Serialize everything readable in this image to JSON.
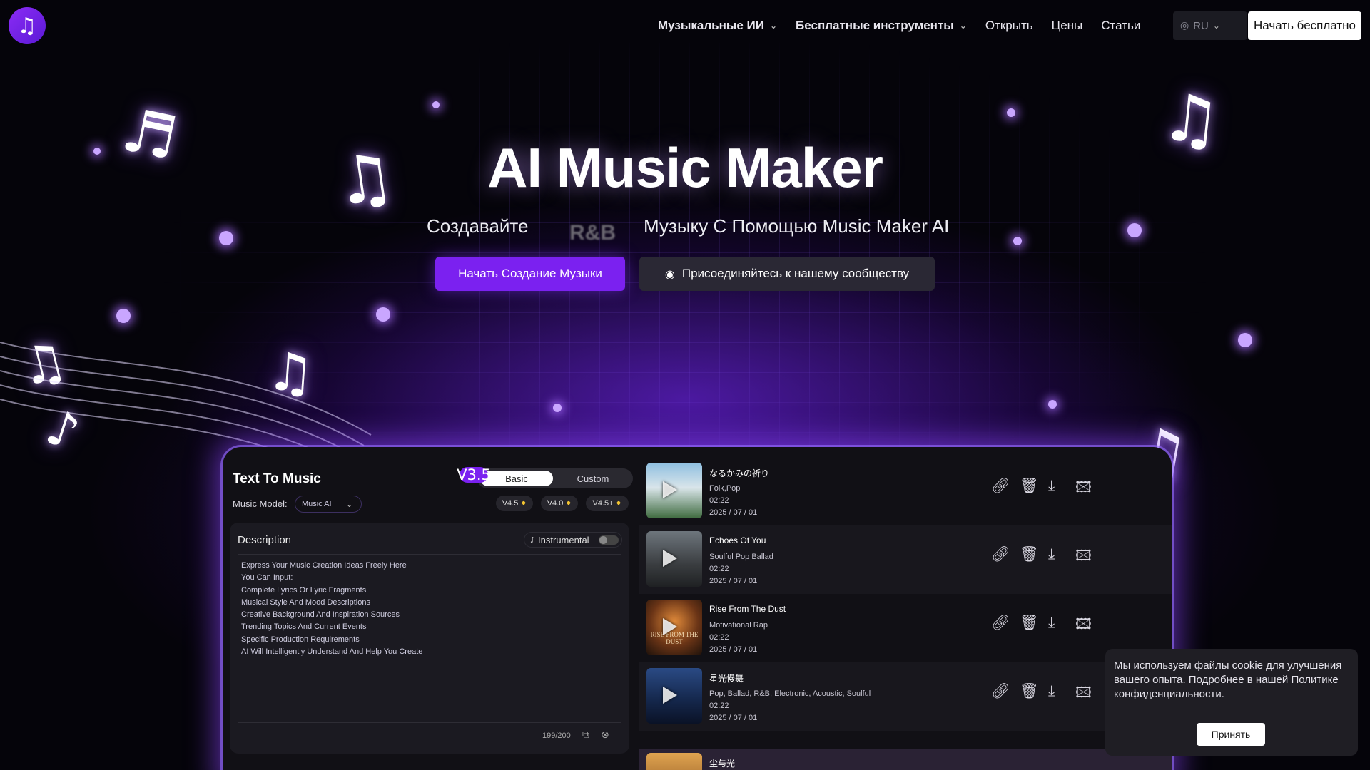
{
  "header": {
    "logo_glyph": "♫",
    "nav": [
      {
        "label": "Музыкальные ИИ",
        "dropdown": true
      },
      {
        "label": "Бесплатные инструменты",
        "dropdown": true
      },
      {
        "label": "Открыть",
        "dropdown": false
      },
      {
        "label": "Цены",
        "dropdown": false
      },
      {
        "label": "Статьи",
        "dropdown": false
      }
    ],
    "language": "RU",
    "start_free": "Начать бесплатно"
  },
  "hero": {
    "title": "AI Music Maker",
    "subtitle_left": "Создавайте",
    "rotating_word": "R&B",
    "subtitle_right": "Музыку С Помощью Music Maker AI",
    "create_button": "Начать Создание Музыки",
    "community_button": "Присоединяйтесь к нашему сообществу"
  },
  "panel": {
    "title": "Text To Music",
    "tabs": [
      "Basic",
      "Custom"
    ],
    "active_tab": "Basic",
    "model_label": "Music Model:",
    "model_value": "Music AI",
    "versions": [
      {
        "label": "V3.5",
        "premium": false,
        "active": true
      },
      {
        "label": "V4.5",
        "premium": true,
        "active": false
      },
      {
        "label": "V4.0",
        "premium": true,
        "active": false
      },
      {
        "label": "V4.5+",
        "premium": true,
        "active": false
      }
    ],
    "description_label": "Description",
    "instrumental_label": "Instrumental",
    "instrumental_on": false,
    "description_lines": [
      "Express Your Music Creation Ideas Freely Here",
      "You Can Input:",
      "Complete Lyrics Or Lyric Fragments",
      "Musical Style And Mood Descriptions",
      "Creative Background And Inspiration Sources",
      "Trending Topics And Current Events",
      "Specific Production Requirements",
      "AI Will Intelligently Understand And Help You Create"
    ],
    "char_count": "199/200"
  },
  "songs": [
    {
      "title": "なるかみの祈り",
      "genre": "Folk,Pop",
      "duration": "02:22",
      "date": "2025 / 07 / 01",
      "cover_colors": [
        "#7fb0d6",
        "#3b5e3a"
      ]
    },
    {
      "title": "Echoes Of You",
      "genre": "Soulful Pop Ballad",
      "duration": "02:22",
      "date": "2025 / 07 / 01",
      "cover_colors": [
        "#5a6168",
        "#2c2f33"
      ]
    },
    {
      "title": "Rise From The Dust",
      "genre": "Motivational Rap",
      "duration": "02:22",
      "date": "2025 / 07 / 01",
      "cover_colors": [
        "#b06a2c",
        "#2a1810"
      ],
      "cover_text": "RISE FROM THE DUST"
    },
    {
      "title": "星光慢舞",
      "genre": "Pop, Ballad, R&B, Electronic, Acoustic, Soulful",
      "duration": "02:22",
      "date": "2025 / 07 / 01",
      "cover_colors": [
        "#2e4f8a",
        "#0e1730"
      ]
    },
    {
      "title": "尘与光",
      "genre": "",
      "duration": "",
      "date": "",
      "cover_colors": [
        "#d69a4a",
        "#6b3c18"
      ]
    }
  ],
  "cookie": {
    "text": "Мы используем файлы cookie для улучшения вашего опыта. Подробнее в нашей Политике конфиденциальности.",
    "accept": "Принять"
  },
  "colors": {
    "accent": "#7b21f0",
    "background": "#05040a",
    "panel": "#111015"
  }
}
